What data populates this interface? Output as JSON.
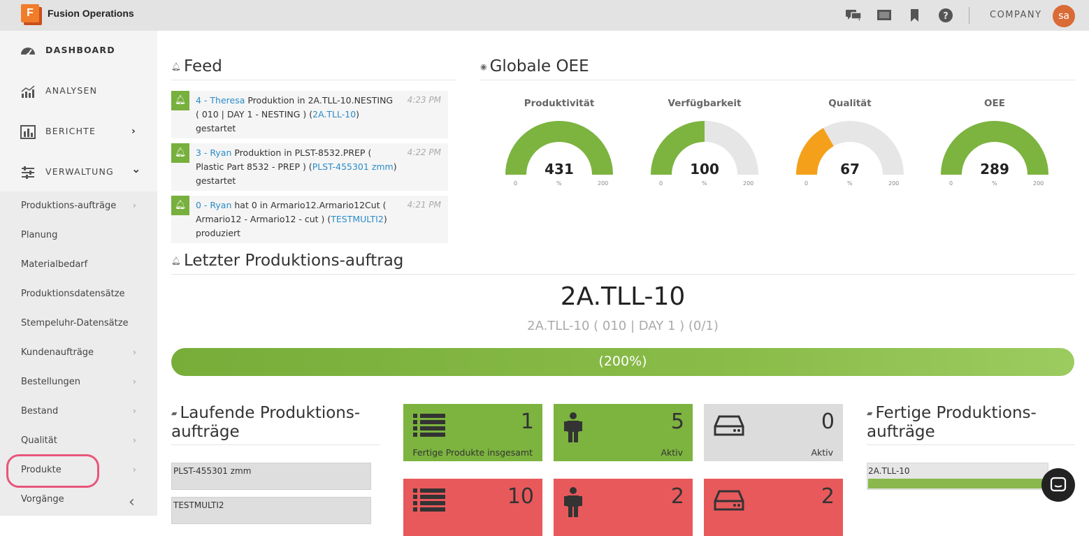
{
  "app": {
    "title": "Fusion Operations",
    "logo_letter": "F"
  },
  "topbar": {
    "icons": [
      "chat-icon",
      "screen-icon",
      "bookmark-icon",
      "help-icon"
    ],
    "company": "COMPANY",
    "avatar_initials": "sa"
  },
  "sidebar": {
    "main": [
      {
        "label": "DASHBOARD",
        "icon": "dashboard-icon",
        "active": true
      },
      {
        "label": "ANALYSEN",
        "icon": "analytics-icon"
      },
      {
        "label": "BERICHTE",
        "icon": "reports-icon",
        "chevron": "›"
      },
      {
        "label": "VERWALTUNG",
        "icon": "settings-sliders-icon",
        "chevron": "⌄"
      }
    ],
    "sub": [
      {
        "label": "Produktions-aufträge",
        "chevron": "›"
      },
      {
        "label": "Planung"
      },
      {
        "label": "Materialbedarf"
      },
      {
        "label": "Produktionsdatensätze"
      },
      {
        "label": "Stempeluhr-Datensätze"
      },
      {
        "label": "Kundenaufträge",
        "chevron": "›"
      },
      {
        "label": "Bestellungen",
        "chevron": "›"
      },
      {
        "label": "Bestand",
        "chevron": "›"
      },
      {
        "label": "Qualität",
        "chevron": "›"
      },
      {
        "label": "Produkte",
        "chevron": "›"
      },
      {
        "label": "Vorgänge"
      }
    ],
    "collapse_icon": "‹"
  },
  "feed": {
    "title": "Feed",
    "items": [
      {
        "link1": "4 - Theresa",
        "t1": " Produktion in 2A.TLL-10.NESTING ( 010 | DAY 1 - NESTING ) (",
        "link2": "2A.TLL-10",
        "t2": ") gestartet",
        "time": "4:23 PM"
      },
      {
        "link1": "3 - Ryan",
        "t1": " Produktion in PLST-8532.PREP ( Plastic Part 8532 - PREP ) (",
        "link2": "PLST-455301 zmm",
        "t2": ") gestartet",
        "time": "4:22 PM"
      },
      {
        "link1": "0 - Ryan",
        "t1": " hat 0 in Armario12.Armario12Cut ( Armario12 - Armario12 - cut ) (",
        "link2": "TESTMULTI2",
        "t2": ") produziert",
        "time": "4:21 PM"
      }
    ]
  },
  "oee": {
    "title": "Globale OEE",
    "gauges": [
      {
        "label": "Produktivität",
        "value": "431",
        "fraction": 1.0,
        "color": "#7cb43f",
        "min": "0",
        "unit": "%",
        "max": "200"
      },
      {
        "label": "Verfügbarkeit",
        "value": "100",
        "fraction": 0.5,
        "color": "#7cb43f",
        "min": "0",
        "unit": "%",
        "max": "200"
      },
      {
        "label": "Qualität",
        "value": "67",
        "fraction": 0.335,
        "color": "#f5a01a",
        "min": "0",
        "unit": "%",
        "max": "200"
      },
      {
        "label": "OEE",
        "value": "289",
        "fraction": 1.0,
        "color": "#7cb43f",
        "min": "0",
        "unit": "%",
        "max": "200"
      }
    ]
  },
  "last_order": {
    "title": "Letzter Produktions-auftrag",
    "name": "2A.TLL-10",
    "subtitle": "2A.TLL-10 ( 010 | DAY 1 ) (0/1)",
    "progress_label": "(200%)",
    "progress_percent": 200
  },
  "running": {
    "title_line1": "Laufende Produktions-",
    "title_line2": "aufträge",
    "items": [
      "PLST-455301 zmm",
      "TESTMULTI2"
    ]
  },
  "tiles": [
    {
      "value": "1",
      "label": "Fertige Produkte insgesamt",
      "icon": "list-icon",
      "color": "green"
    },
    {
      "value": "5",
      "label": "Aktiv",
      "icon": "person-icon",
      "color": "green"
    },
    {
      "value": "0",
      "label": "Aktiv",
      "icon": "drive-icon",
      "color": "grey"
    },
    {
      "value": "10",
      "label": "",
      "icon": "list-icon",
      "color": "red"
    },
    {
      "value": "2",
      "label": "",
      "icon": "person-icon",
      "color": "red"
    },
    {
      "value": "2",
      "label": "",
      "icon": "drive-icon",
      "color": "red"
    }
  ],
  "finished": {
    "title_line1": "Fertige Produktions-",
    "title_line2": "aufträge",
    "items": [
      {
        "label": "2A.TLL-10",
        "progress": 1.0
      }
    ]
  },
  "chat_widget": {
    "icon": "chat-bubble-icon"
  }
}
